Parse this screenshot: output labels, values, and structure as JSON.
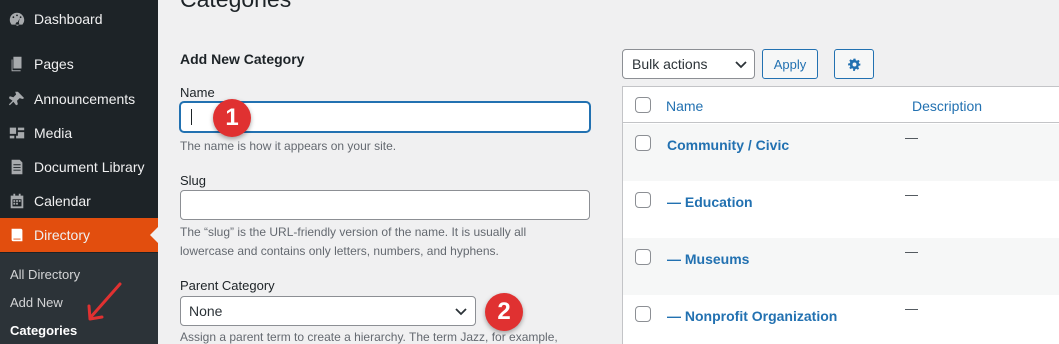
{
  "sidebar": {
    "items": [
      {
        "label": "Dashboard",
        "icon": "dashboard-icon"
      },
      {
        "label": "Pages",
        "icon": "pages-icon"
      },
      {
        "label": "Announcements",
        "icon": "pin-icon"
      },
      {
        "label": "Media",
        "icon": "media-icon"
      },
      {
        "label": "Document Library",
        "icon": "document-icon"
      },
      {
        "label": "Calendar",
        "icon": "calendar-icon"
      },
      {
        "label": "Directory",
        "icon": "book-icon"
      }
    ],
    "submenu": [
      "All Directory",
      "Add New",
      "Categories"
    ]
  },
  "page": {
    "heading": "Categories"
  },
  "form": {
    "title": "Add New Category",
    "name_label": "Name",
    "name_value": "",
    "name_help": "The name is how it appears on your site.",
    "slug_label": "Slug",
    "slug_value": "",
    "slug_help_1": "The “slug” is the URL-friendly version of the name. It is usually all",
    "slug_help_2": "lowercase and contains only letters, numbers, and hyphens.",
    "parent_label": "Parent Category",
    "parent_value": "None",
    "parent_help": "Assign a parent term to create a hierarchy. The term Jazz, for example,"
  },
  "badges": {
    "one": "1",
    "two": "2"
  },
  "table": {
    "bulk_value": "Bulk actions",
    "apply_label": "Apply",
    "col_name": "Name",
    "col_description": "Description",
    "rows": [
      {
        "name": "Community / Civic",
        "description": "—"
      },
      {
        "name": "— Education",
        "description": "—"
      },
      {
        "name": "— Museums",
        "description": "—"
      },
      {
        "name": "— Nonprofit Organization",
        "description": "—"
      }
    ]
  },
  "colors": {
    "accent": "#2271b1",
    "active_menu": "#e24e0e",
    "badge": "#e03131",
    "arrow": "#e03131"
  }
}
